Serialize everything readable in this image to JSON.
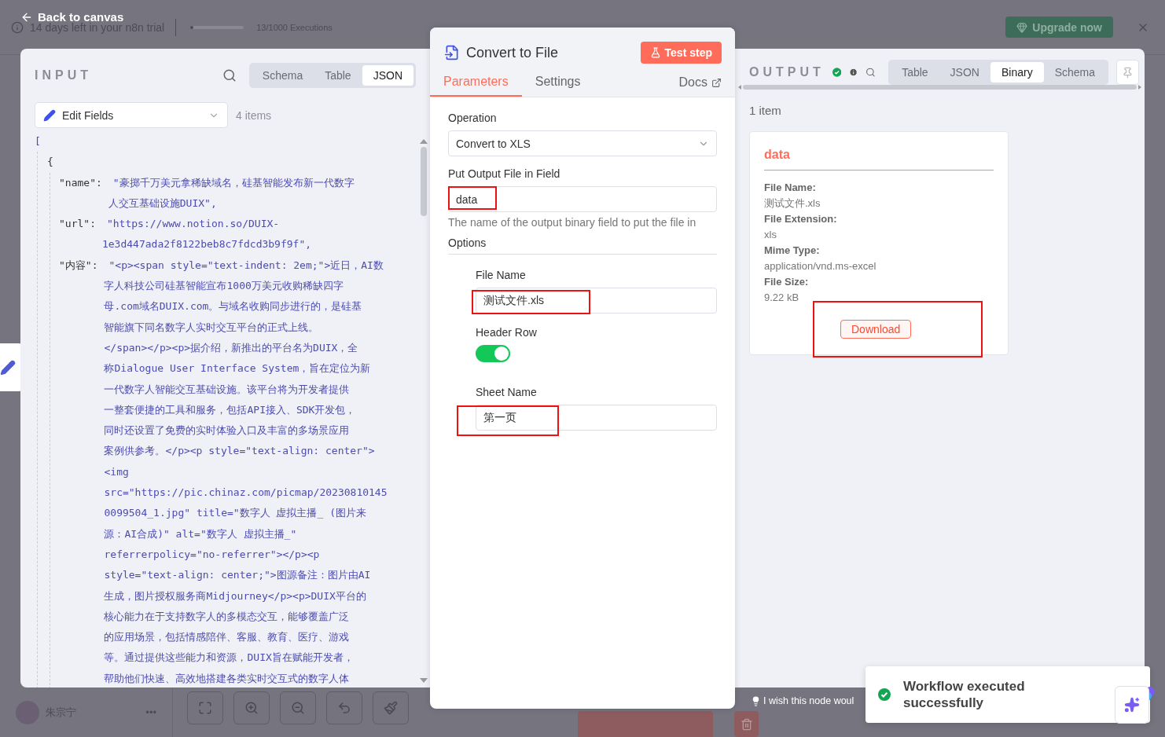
{
  "top_bar": {
    "back_link": "Back to canvas",
    "trial_notice": "14 days left in your n8n trial",
    "usage": {
      "level": 0.013,
      "reading": "13/1000 Executions"
    },
    "upgrade_button": "Upgrade now"
  },
  "input": {
    "title": "INPUT",
    "tabs": [
      {
        "label": "Schema",
        "selected": false
      },
      {
        "label": "Table",
        "selected": false
      },
      {
        "label": "JSON",
        "selected": true
      }
    ],
    "node_select": "Edit Fields",
    "item_count": "4 items",
    "json_view": {
      "array_open": "[",
      "object_open": "{",
      "fields": [
        {
          "key": "\"name\":",
          "value_lines": [
            "\"豪掷千万美元拿稀缺域名，硅基智能发布新一代数字",
            "人交互基础设施DUIX\","
          ]
        },
        {
          "key": "\"url\":",
          "value_lines": [
            "\"https://www.notion.so/DUIX-",
            "1e3d447ada2f8122beb8c7fdcd3b9f9f\","
          ]
        },
        {
          "key": "\"内容\":",
          "value_lines": [
            "\"<p><span style=\"text-indent: 2em;\">近日，AI数",
            "字人科技公司硅基智能宣布1000万美元收购稀缺四字",
            "母.com域名DUIX.com。与域名收购同步进行的，是硅基",
            "智能旗下同名数字人实时交互平台的正式上线。",
            "</span></p><p>据介绍，新推出的平台名为DUIX，全",
            "称Dialogue User Interface System，旨在定位为新",
            "一代数字人智能交互基础设施。该平台将为开发者提供",
            "一整套便捷的工具和服务，包括API接入、SDK开发包，",
            "同时还设置了免费的实时体验入口及丰富的多场景应用",
            "案例供参考。</p><p style=\"text-align: center\">",
            "<img",
            "src=\"https://pic.chinaz.com/picmap/20230810145",
            "0099504_1.jpg\" title=\"数字人 虚拟主播_ (图片来",
            "源：AI合成)\" alt=\"数字人 虚拟主播_\"",
            "referrerpolicy=\"no-referrer\"></p><p",
            "style=\"text-align: center;\">图源备注：图片由AI",
            "生成，图片授权服务商Midjourney</p><p>DUIX平台的",
            "核心能力在于支持数字人的多模态交互，能够覆盖广泛",
            "的应用场景，包括情感陪伴、客服、教育、医疗、游戏",
            "等。通过提供这些能力和资源，DUIX旨在赋能开发者，",
            "帮助他们快速、高效地搭建各类实时交互式的数字人体"
          ]
        }
      ]
    }
  },
  "node": {
    "title": "Convert to File",
    "test_button": "Test step",
    "tabs": [
      {
        "label": "Parameters",
        "selected": true
      },
      {
        "label": "Settings",
        "selected": false
      }
    ],
    "docs_link": "Docs",
    "parameters": {
      "operation": {
        "label": "Operation",
        "value": "Convert to XLS"
      },
      "output_field": {
        "label": "Put Output File in Field",
        "value": "data",
        "hint": "The name of the output binary field to put the file in",
        "highlighted": true
      },
      "options_title": "Options",
      "file_name": {
        "label": "File Name",
        "value": "测试文件.xls",
        "highlighted": true
      },
      "header_row": {
        "label": "Header Row",
        "on": true
      },
      "sheet_name": {
        "label": "Sheet Name",
        "value": "第一页",
        "highlighted": true
      }
    }
  },
  "output": {
    "title": "OUTPUT",
    "tabs": [
      {
        "label": "Table",
        "selected": false
      },
      {
        "label": "JSON",
        "selected": false
      },
      {
        "label": "Binary",
        "selected": true
      },
      {
        "label": "Schema",
        "selected": false
      }
    ],
    "item_count": "1 item",
    "binary": {
      "name": "data",
      "properties": [
        {
          "label": "File Name:",
          "value": "测试文件.xls"
        },
        {
          "label": "File Extension:",
          "value": "xls"
        },
        {
          "label": "Mime Type:",
          "value": "application/vnd.ms-excel"
        },
        {
          "label": "File Size:",
          "value": "9.22 kB"
        }
      ],
      "download_button": "Download",
      "highlighted": true
    }
  },
  "bottom_bar": {
    "user_name": "朱宗宁",
    "more": "•••",
    "feedback": "I wish this node woul"
  },
  "toast": {
    "message": "Workflow executed successfully"
  }
}
